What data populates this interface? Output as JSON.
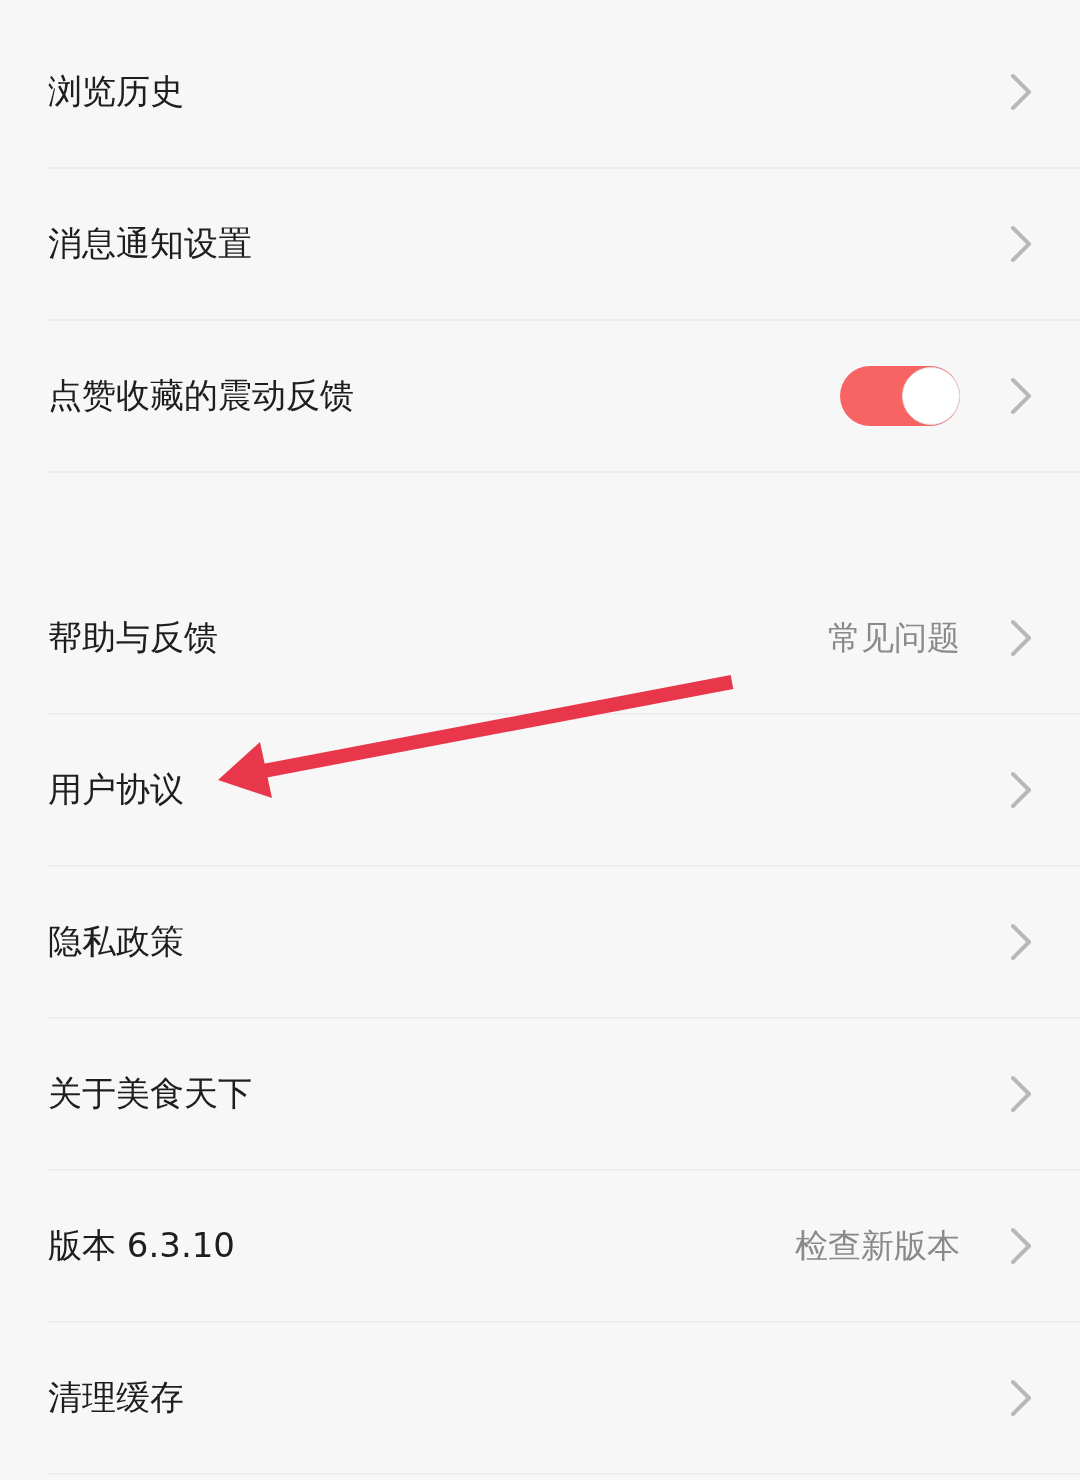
{
  "groups": [
    {
      "items": [
        {
          "kind": "link",
          "label": "浏览历史"
        },
        {
          "kind": "link",
          "label": "消息通知设置"
        },
        {
          "kind": "toggle",
          "label": "点赞收藏的震动反馈",
          "on": true
        }
      ]
    },
    {
      "items": [
        {
          "kind": "link",
          "label": "帮助与反馈",
          "value": "常见问题"
        },
        {
          "kind": "link",
          "label": "用户协议"
        },
        {
          "kind": "link",
          "label": "隐私政策"
        },
        {
          "kind": "link",
          "label": "关于美食天下"
        },
        {
          "kind": "link",
          "label": "版本 6.3.10",
          "value": "检查新版本"
        },
        {
          "kind": "link",
          "label": "清理缓存"
        }
      ]
    }
  ],
  "annotation": {
    "kind": "arrow"
  }
}
